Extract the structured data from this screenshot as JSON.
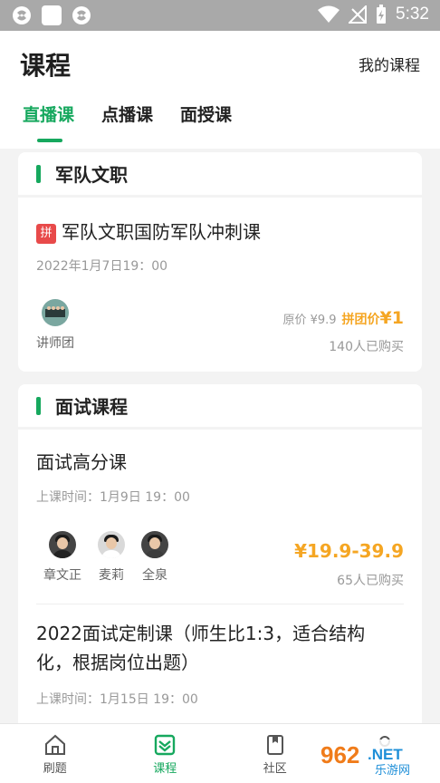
{
  "status": {
    "time": "5:32"
  },
  "header": {
    "title": "课程",
    "my_courses": "我的课程"
  },
  "tabs": [
    {
      "label": "直播课",
      "active": true
    },
    {
      "label": "点播课",
      "active": false
    },
    {
      "label": "面授课",
      "active": false
    }
  ],
  "section1": {
    "title": "军队文职",
    "course": {
      "badge": "拼",
      "title": "军队文职国防军队冲刺课",
      "time": "2022年1月7日19：00",
      "teacher": "讲师团",
      "original_price": "原价 ¥9.9",
      "group_label": "拼团价",
      "group_price": "¥1",
      "buyers": "140人已购买"
    }
  },
  "section2": {
    "title": "面试课程",
    "courses": [
      {
        "title": "面试高分课",
        "time": "上课时间：1月9日 19：00",
        "teachers": [
          "章文正",
          "麦莉",
          "全泉"
        ],
        "price": "¥19.9-39.9",
        "buyers": "65人已购买"
      },
      {
        "title_line1": "2022面试定制课（师生比1:3，适合结构",
        "title_line2": "化，根据岗位出题）",
        "time": "上课时间：1月15日 19：00"
      }
    ]
  },
  "bottom_nav": [
    {
      "label": "刷题",
      "icon": "home-icon",
      "active": false
    },
    {
      "label": "课程",
      "icon": "course-icon",
      "active": true
    },
    {
      "label": "社区",
      "icon": "book-icon",
      "active": false
    }
  ],
  "watermark": {
    "brand": "962.NET",
    "sub": "乐游网"
  },
  "colors": {
    "accent": "#16a85e",
    "price": "#f5a623",
    "badge": "#e84a4a"
  }
}
